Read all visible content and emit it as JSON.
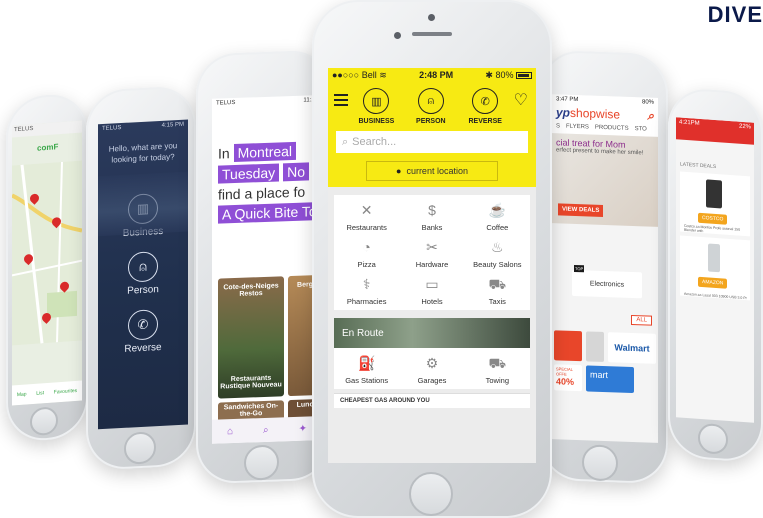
{
  "corner_title": "DIVE",
  "phone1": {
    "carrier": "TELUS",
    "logo_text": "comF",
    "nav": [
      "Map",
      "List",
      "Favourites"
    ]
  },
  "phone2": {
    "carrier": "TELUS",
    "time": "4:15 PM",
    "greeting": "Hello, what are you looking for today?",
    "options": [
      "Business",
      "Person",
      "Reverse"
    ]
  },
  "phone3": {
    "carrier": "TELUS",
    "time": "11:10",
    "headline": {
      "word1": "In",
      "city": "Montreal",
      "day": "Tuesday",
      "time_tag": "No",
      "line3": "find a place fo",
      "category": "A Quick Bite To"
    },
    "cards": [
      {
        "title": "Cote-des-Neiges Restos"
      },
      {
        "title": "Berg"
      },
      {
        "title": "Restaurants Rustique Nouveau"
      },
      {
        "title": "Sandwiches On-the-Go"
      },
      {
        "title": "Lunc"
      }
    ],
    "tabs": [
      "Concierge",
      "Search",
      "Explore",
      "Fa"
    ]
  },
  "center": {
    "status": {
      "carrier": "Bell",
      "time": "2:48 PM",
      "battery": "80%"
    },
    "modes": [
      {
        "label": "BUSINESS",
        "icon": "building-icon",
        "glyph": "▥"
      },
      {
        "label": "PERSON",
        "icon": "person-icon",
        "glyph": "⍝"
      },
      {
        "label": "REVERSE",
        "icon": "phone-icon",
        "glyph": "✆"
      }
    ],
    "search_placeholder": "Search...",
    "location_button": "current location",
    "categories": [
      {
        "label": "Restaurants",
        "icon": "utensils-icon",
        "glyph": "✕"
      },
      {
        "label": "Banks",
        "icon": "dollar-icon",
        "glyph": "$"
      },
      {
        "label": "Coffee",
        "icon": "cup-icon",
        "glyph": "☕"
      },
      {
        "label": "Pizza",
        "icon": "pizza-icon",
        "glyph": "◔"
      },
      {
        "label": "Hardware",
        "icon": "tools-icon",
        "glyph": "✂"
      },
      {
        "label": "Beauty Salons",
        "icon": "salon-icon",
        "glyph": "♨"
      },
      {
        "label": "Pharmacies",
        "icon": "pill-icon",
        "glyph": "⚕"
      },
      {
        "label": "Hotels",
        "icon": "bed-icon",
        "glyph": "▭"
      },
      {
        "label": "Taxis",
        "icon": "taxi-icon",
        "glyph": "⛟"
      }
    ],
    "enroute_title": "En Route",
    "route_items": [
      {
        "label": "Gas Stations",
        "icon": "fuel-icon",
        "glyph": "⛽"
      },
      {
        "label": "Garages",
        "icon": "oilcan-icon",
        "glyph": "⚙"
      },
      {
        "label": "Towing",
        "icon": "tow-truck-icon",
        "glyph": "⛟"
      }
    ],
    "cheapest_gas": "CHEAPEST GAS AROUND YOU"
  },
  "phone5": {
    "time": "3:47 PM",
    "battery": "80%",
    "logo_a": "yp",
    "logo_b": "shopwise",
    "tabs": [
      "S",
      "FLYERS",
      "PRODUCTS",
      "STO"
    ],
    "promo_title": "cial treat for Mom",
    "promo_sub": "erfect present to make her smile!",
    "view_deals": "VIEW DEALS",
    "top_badge": "TOP",
    "electronics": "Electronics",
    "all_button": "ALL",
    "walmart": "Walmart",
    "special_offer": "SPECIAL OFFE",
    "discount": "40%",
    "smart": "mart"
  },
  "phone6": {
    "time": "4:21PM",
    "battery": "22%",
    "section": "LATEST DEALS",
    "card1_btn": "COSTCO",
    "card1_text": "Costco.ca Monfos Profe ssional 150 Blender with",
    "card2_btn": "AMAZON",
    "card2_text": "Amazon.ca Lasal 003 10900 USB 3.0 Pr"
  }
}
